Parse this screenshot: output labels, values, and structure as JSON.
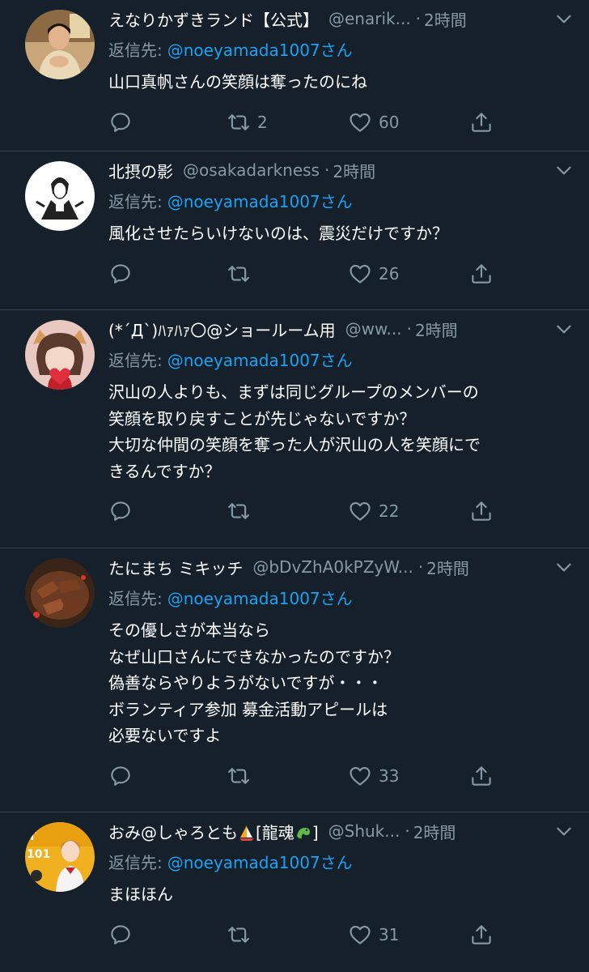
{
  "tweets": [
    {
      "name": "えなりかずきランド【公式】",
      "handle": "@enarik...",
      "separator": "·",
      "time": "2時間",
      "reply_prefix": "返信先:",
      "reply_to": "@noeyamada1007さん",
      "lines": [
        "山口真帆さんの笑顔は奪ったのにね"
      ],
      "reply_count": "",
      "retweet_count": "2",
      "like_count": "60"
    },
    {
      "name": "北摂の影",
      "handle": "@osakadarkness",
      "separator": "·",
      "time": "2時間",
      "reply_prefix": "返信先:",
      "reply_to": "@noeyamada1007さん",
      "lines": [
        "風化させたらいけないのは、震災だけですか？"
      ],
      "reply_count": "",
      "retweet_count": "",
      "like_count": "26"
    },
    {
      "name": "(*´Д`)ﾊｧﾊｧ〇@ショールーム用",
      "handle": "@ww...",
      "separator": "·",
      "time": "2時間",
      "reply_prefix": "返信先:",
      "reply_to": "@noeyamada1007さん",
      "lines": [
        "沢山の人よりも、まずは同じグループのメンバーの",
        "笑顔を取り戻すことが先じゃないですか？",
        "大切な仲間の笑顔を奪った人が沢山の人を笑顔にで",
        "きるんですか？"
      ],
      "reply_count": "",
      "retweet_count": "",
      "like_count": "22"
    },
    {
      "name": "たにまち ミキッチ",
      "handle": "@bDvZhA0kPZyW...",
      "separator": "·",
      "time": "2時間",
      "reply_prefix": "返信先:",
      "reply_to": "@noeyamada1007さん",
      "lines": [
        "その優しさが本当なら",
        "なぜ山口さんにできなかったのですか？",
        "偽善ならやりようがないですが・・・",
        "ボランティア参加 募金活動アピールは",
        "必要ないですよ"
      ],
      "reply_count": "",
      "retweet_count": "",
      "like_count": "33"
    },
    {
      "name_prefix": "おみ@しゃろとも",
      "name_mid": "[龍魂",
      "name_suffix": "]",
      "handle": "@Shuk...",
      "separator": "·",
      "time": "2時間",
      "reply_prefix": "返信先:",
      "reply_to": "@noeyamada1007さん",
      "lines": [
        "まほほん"
      ],
      "reply_count": "",
      "retweet_count": "",
      "like_count": "31"
    }
  ],
  "icons": {
    "reply": "reply-icon",
    "retweet": "retweet-icon",
    "like": "heart-icon",
    "share": "share-icon",
    "menu": "chevron-down-icon"
  },
  "colors": {
    "background": "#15202b",
    "divider": "#38444d",
    "secondary_text": "#8899a6",
    "link": "#1da1f2"
  }
}
